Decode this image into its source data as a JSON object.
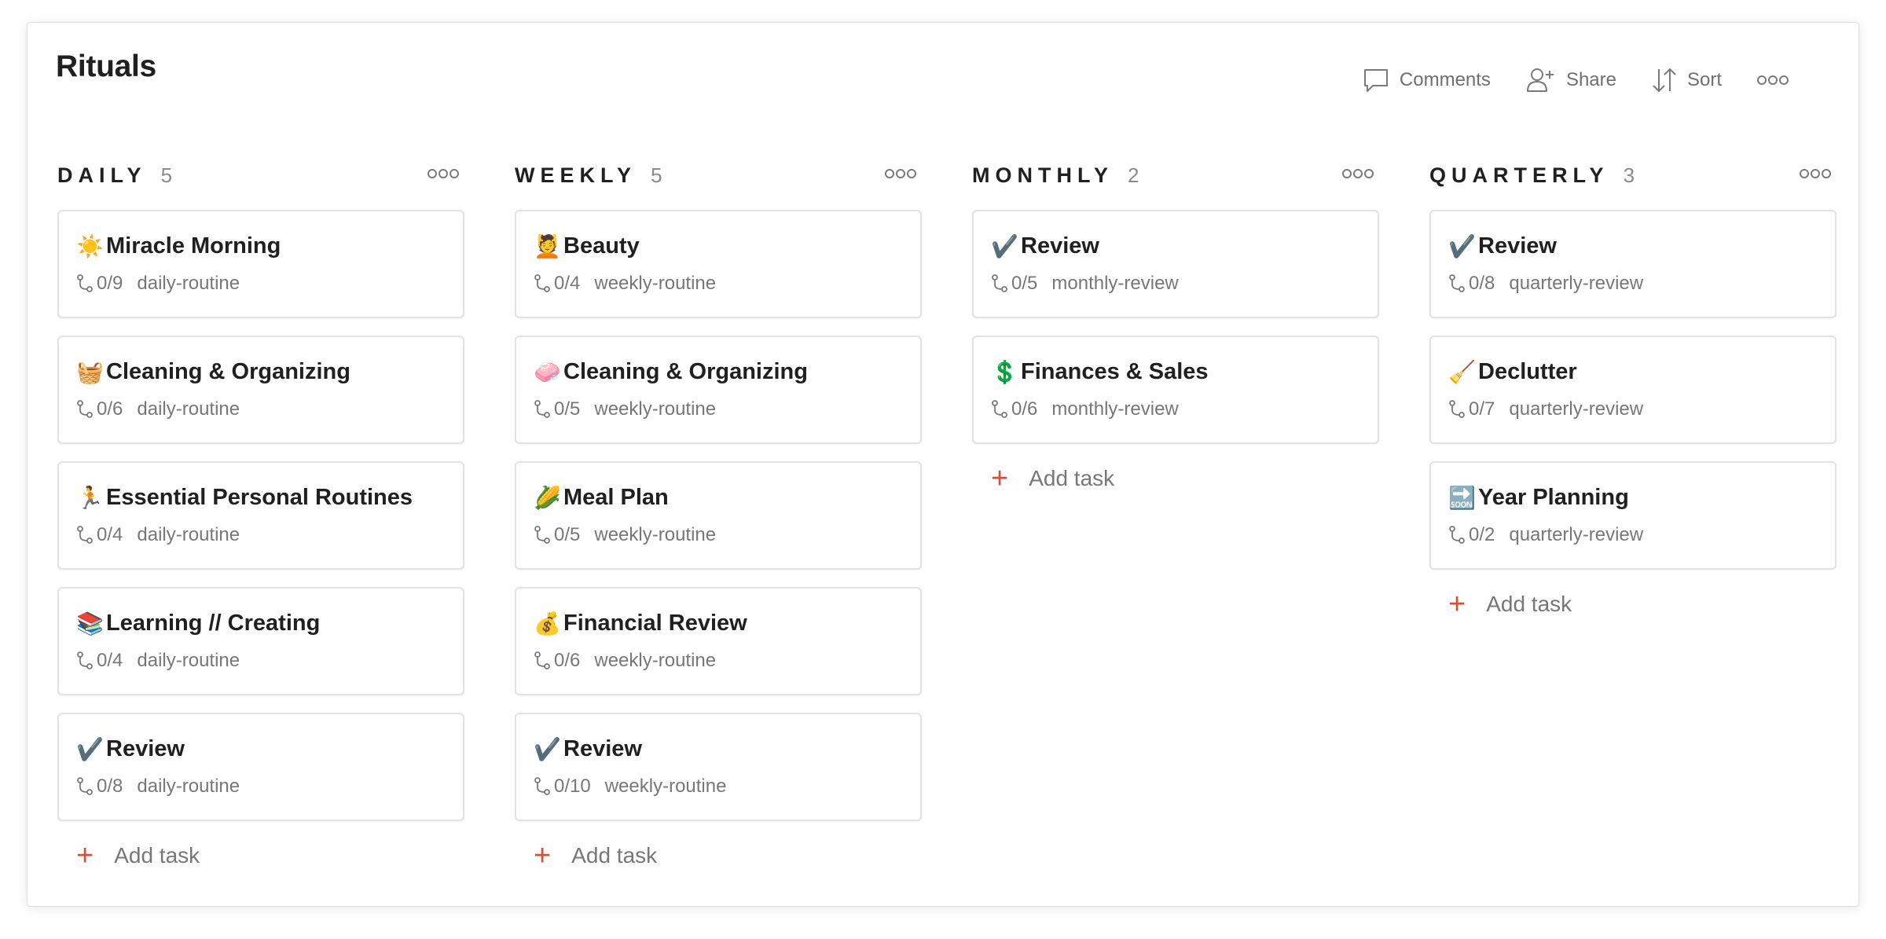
{
  "project": {
    "title": "Rituals"
  },
  "toolbar": {
    "comments_label": "Comments",
    "share_label": "Share",
    "sort_label": "Sort"
  },
  "accent_color": "#dd4b39",
  "add_task_label": "Add task",
  "columns": [
    {
      "title": "DAILY",
      "count": "5",
      "tasks": [
        {
          "emoji": "☀️",
          "title": "Miracle Morning",
          "progress": "0/9",
          "label": "daily-routine"
        },
        {
          "emoji": "🧺",
          "title": "Cleaning & Organizing",
          "progress": "0/6",
          "label": "daily-routine"
        },
        {
          "emoji": "🏃",
          "title": "Essential Personal Routines",
          "progress": "0/4",
          "label": "daily-routine"
        },
        {
          "emoji": "📚",
          "title": "Learning // Creating",
          "progress": "0/4",
          "label": "daily-routine"
        },
        {
          "emoji": "✔️",
          "title": "Review",
          "progress": "0/8",
          "label": "daily-routine"
        }
      ]
    },
    {
      "title": "WEEKLY",
      "count": "5",
      "tasks": [
        {
          "emoji": "💆",
          "title": "Beauty",
          "progress": "0/4",
          "label": "weekly-routine"
        },
        {
          "emoji": "🧼",
          "title": "Cleaning & Organizing",
          "progress": "0/5",
          "label": "weekly-routine"
        },
        {
          "emoji": "🌽",
          "title": "Meal Plan",
          "progress": "0/5",
          "label": "weekly-routine"
        },
        {
          "emoji": "💰",
          "title": "Financial Review",
          "progress": "0/6",
          "label": "weekly-routine"
        },
        {
          "emoji": "✔️",
          "title": "Review",
          "progress": "0/10",
          "label": "weekly-routine"
        }
      ]
    },
    {
      "title": "MONTHLY",
      "count": "2",
      "tasks": [
        {
          "emoji": "✔️",
          "title": "Review",
          "progress": "0/5",
          "label": "monthly-review"
        },
        {
          "emoji": "💲",
          "title": "Finances & Sales",
          "progress": "0/6",
          "label": "monthly-review"
        }
      ]
    },
    {
      "title": "QUARTERLY",
      "count": "3",
      "tasks": [
        {
          "emoji": "✔️",
          "title": "Review",
          "progress": "0/8",
          "label": "quarterly-review"
        },
        {
          "emoji": "🧹",
          "title": "Declutter",
          "progress": "0/7",
          "label": "quarterly-review"
        },
        {
          "emoji": "🔜",
          "title": "Year Planning",
          "progress": "0/2",
          "label": "quarterly-review"
        }
      ]
    }
  ]
}
